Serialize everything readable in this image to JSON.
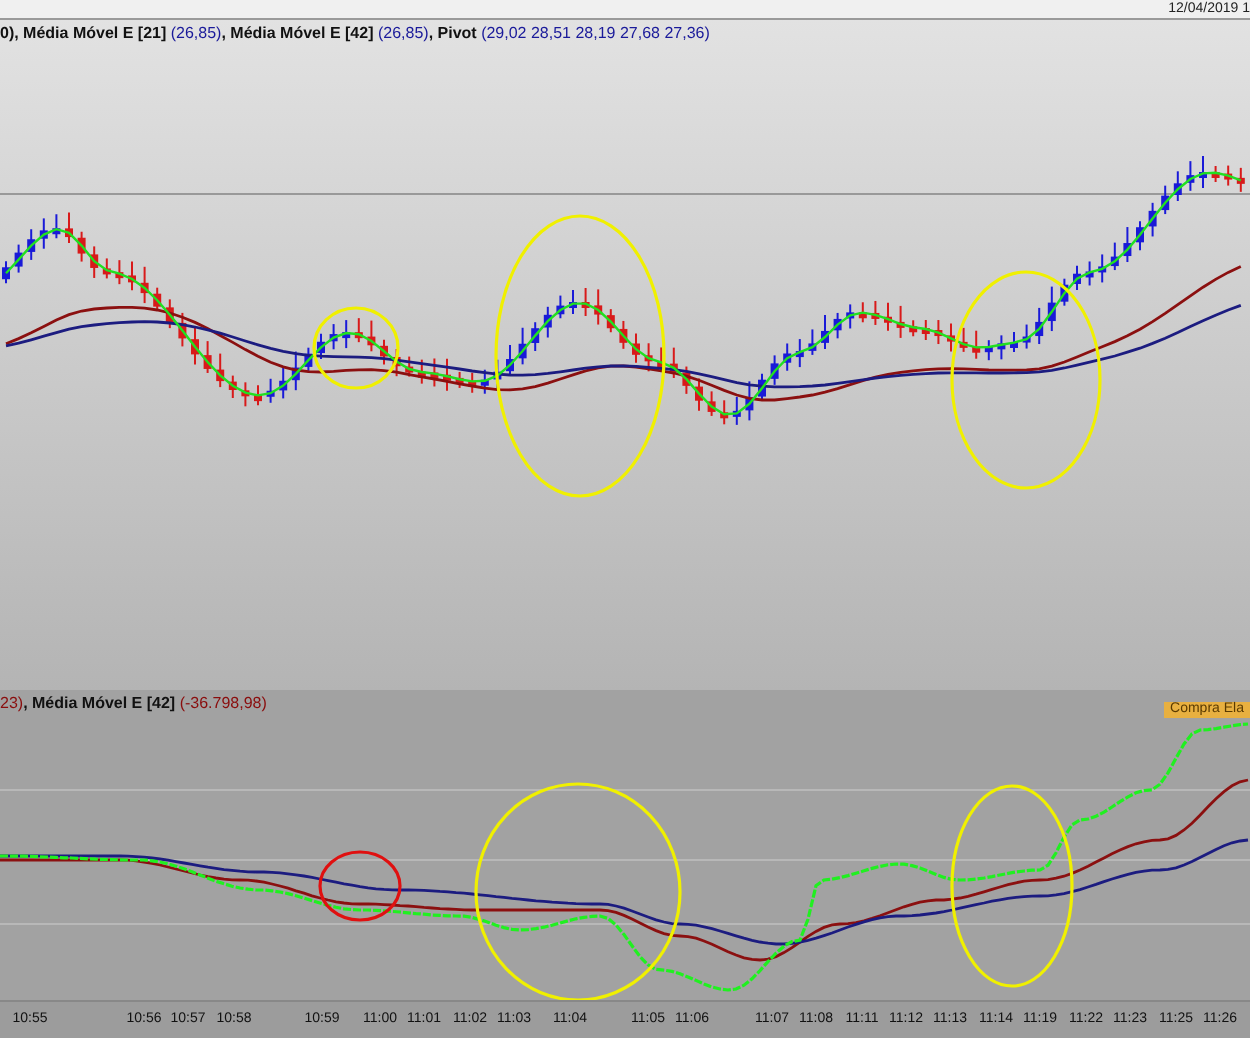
{
  "top_bar": {
    "date": "12/04/2019 1"
  },
  "upper_panel": {
    "legend": [
      {
        "text": "0), Média Móvel E [21] ",
        "kind": "label"
      },
      {
        "text": "(26,85)",
        "kind": "value"
      },
      {
        "text": ", Média Móvel E [42] ",
        "kind": "label"
      },
      {
        "text": "(26,85)",
        "kind": "value"
      },
      {
        "text": ", Pivot ",
        "kind": "label"
      },
      {
        "text": "(29,02  28,51  28,19  27,68  27,36)",
        "kind": "value"
      }
    ]
  },
  "lower_panel": {
    "legend": [
      {
        "text": "23)",
        "kind": "value"
      },
      {
        "text": ", Média Móvel E [42] ",
        "kind": "label"
      },
      {
        "text": "(-36.798,98)",
        "kind": "value"
      }
    ],
    "tag": "Compra Ela"
  },
  "x_axis": {
    "labels": [
      "10:55",
      "10:56",
      "10:57",
      "10:58",
      "10:59",
      "11:00",
      "11:01",
      "11:02",
      "11:03",
      "11:04",
      "11:05",
      "11:06",
      "11:07",
      "11:08",
      "11:11",
      "11:12",
      "11:13",
      "11:14",
      "11:19",
      "11:22",
      "11:23",
      "11:25",
      "11:26"
    ]
  }
}
